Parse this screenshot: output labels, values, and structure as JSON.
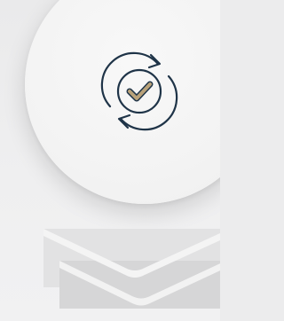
{
  "scene": {
    "background_color": "#ececed",
    "disc_color": "#f5f5f5"
  },
  "sync_badge": {
    "icon_name": "sync-check-icon",
    "stroke_color": "#1f3448",
    "check_fill_color": "#b9a27a"
  },
  "envelope": {
    "icon_name": "envelope-icon",
    "back_color": "#e2e2e3",
    "front_color": "#d6d6d7",
    "flap_color": "#f4f4f4"
  }
}
